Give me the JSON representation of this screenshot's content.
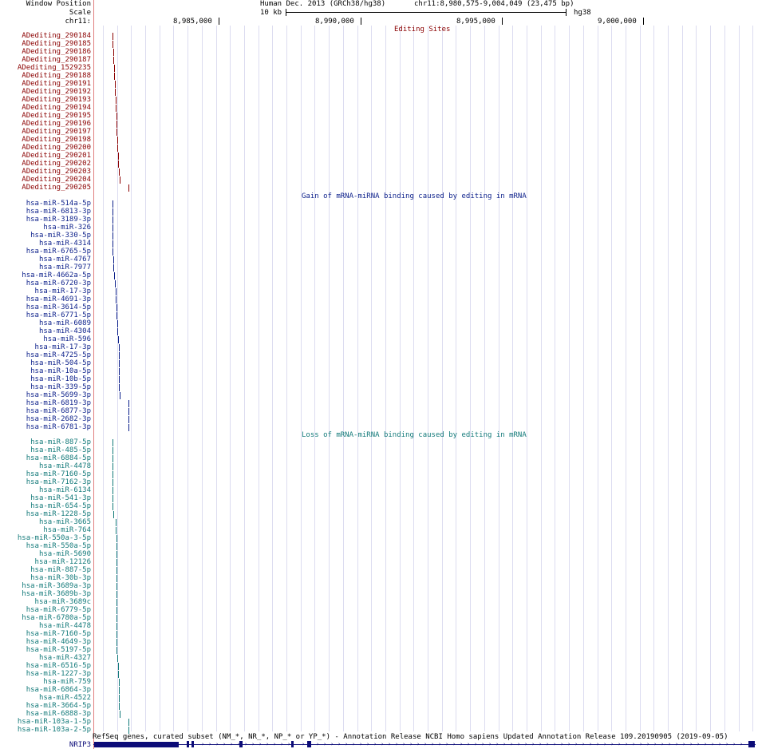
{
  "header": {
    "window_position_label": "Window Position",
    "scale_label": "Scale",
    "chrom_label": "chr11:",
    "assembly_text": "Human Dec. 2013 (GRCh38/hg38)",
    "position_text": "chr11:8,980,575-9,004,049 (23,475 bp)",
    "scale_text": "10 kb",
    "db_text": "hg38",
    "ruler_ticks": [
      "8,985,000",
      "8,990,000",
      "8,995,000",
      "9,000,000"
    ]
  },
  "tracks": {
    "editing": {
      "title": "Editing Sites",
      "color": "#8b0000",
      "items": [
        "ADediting_290184",
        "ADediting_290185",
        "ADediting_290186",
        "ADediting_290187",
        "ADediting_1529235",
        "ADediting_290188",
        "ADediting_290191",
        "ADediting_290192",
        "ADediting_290193",
        "ADediting_290194",
        "ADediting_290195",
        "ADediting_290196",
        "ADediting_290197",
        "ADediting_290198",
        "ADediting_290200",
        "ADediting_290201",
        "ADediting_290202",
        "ADediting_290203",
        "ADediting_290204",
        "ADediting_290205"
      ]
    },
    "gain": {
      "title": "Gain of mRNA-miRNA binding caused by editing in mRNA",
      "color": "#0b1f8a",
      "items": [
        "hsa-miR-514a-5p",
        "hsa-miR-6813-3p",
        "hsa-miR-3189-3p",
        "hsa-miR-326",
        "hsa-miR-330-5p",
        "hsa-miR-4314",
        "hsa-miR-6765-5p",
        "hsa-miR-4767",
        "hsa-miR-7977",
        "hsa-miR-4662a-5p",
        "hsa-miR-6720-3p",
        "hsa-miR-17-3p",
        "hsa-miR-4691-3p",
        "hsa-miR-3614-5p",
        "hsa-miR-6771-5p",
        "hsa-miR-6089",
        "hsa-miR-4304",
        "hsa-miR-596",
        "hsa-miR-17-3p",
        "hsa-miR-4725-5p",
        "hsa-miR-504-5p",
        "hsa-miR-10a-5p",
        "hsa-miR-10b-5p",
        "hsa-miR-339-5p",
        "hsa-miR-5699-3p",
        "hsa-miR-6819-3p",
        "hsa-miR-6877-3p",
        "hsa-miR-2682-3p",
        "hsa-miR-6781-3p"
      ]
    },
    "loss": {
      "title": "Loss of mRNA-miRNA binding caused by editing in mRNA",
      "color": "#137a7a",
      "items": [
        "hsa-miR-887-5p",
        "hsa-miR-485-5p",
        "hsa-miR-6884-5p",
        "hsa-miR-4478",
        "hsa-miR-7160-5p",
        "hsa-miR-7162-3p",
        "hsa-miR-6134",
        "hsa-miR-541-3p",
        "hsa-miR-654-5p",
        "hsa-miR-1228-5p",
        "hsa-miR-3665",
        "hsa-miR-764",
        "hsa-miR-550a-3-5p",
        "hsa-miR-550a-5p",
        "hsa-miR-5690",
        "hsa-miR-12126",
        "hsa-miR-887-5p",
        "hsa-miR-30b-3p",
        "hsa-miR-3689a-3p",
        "hsa-miR-3689b-3p",
        "hsa-miR-3689c",
        "hsa-miR-6779-5p",
        "hsa-miR-6780a-5p",
        "hsa-miR-4478",
        "hsa-miR-7160-5p",
        "hsa-miR-4649-3p",
        "hsa-miR-5197-5p",
        "hsa-miR-4327",
        "hsa-miR-6516-5p",
        "hsa-miR-1227-3p",
        "hsa-miR-759",
        "hsa-miR-6864-3p",
        "hsa-miR-4522",
        "hsa-miR-3664-5p",
        "hsa-miR-6888-3p",
        "hsa-miR-103a-1-5p",
        "hsa-miR-103a-2-5p"
      ]
    },
    "refseq": {
      "title": "RefSeq genes, curated subset (NM_*, NR_*, NP_* or YP_*) - Annotation Release NCBI Homo sapiens Updated Annotation Release 109.20190905 (2019-09-05)",
      "gene": "NRIP3",
      "color": "#0c0c78"
    }
  }
}
